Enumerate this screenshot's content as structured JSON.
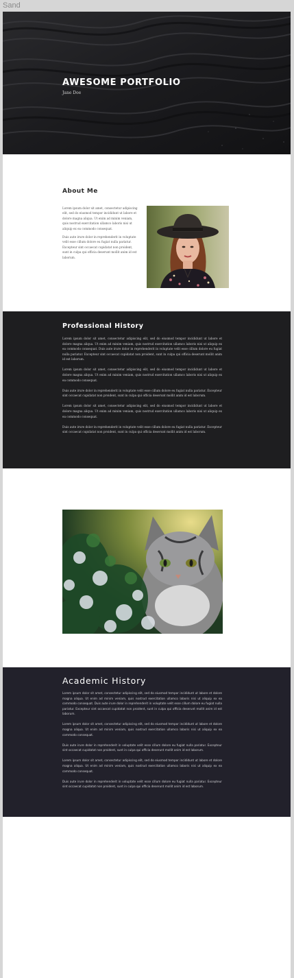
{
  "frame": {
    "label": "Sand"
  },
  "hero": {
    "title": "AWESOME PORTFOLIO",
    "subtitle": "Jane Doe",
    "background_image": "dark-sand-dunes-photo"
  },
  "about": {
    "heading": "About Me",
    "paragraphs": [
      "Lorem ipsum dolor sit amet, consectetur adipiscing elit, sed do eiusmod tempor incididunt ut labore et dolore magna aliqua. Ut enim ad minim veniam, quis nostrud exercitation ullamco laboris nisi ut aliquip ex ea commodo consequat.",
      "Duis aute irure dolor in reprehenderit in voluptate velit esse cillum dolore eu fugiat nulla pariatur. Excepteur sint occaecat cupidatat non proident, sunt in culpa qui officia deserunt mollit anim id est laborum."
    ],
    "image": "portrait-woman-in-hat-photo"
  },
  "professional": {
    "heading": "Professional History",
    "paragraphs": [
      "Lorem ipsum dolor sit amet, consectetur adipiscing elit, sed do eiusmod tempor incididunt ut labore et dolore magna aliqua. Ut enim ad minim veniam, quis nostrud exercitation ullamco laboris nisi ut aliquip ex ea commodo consequat. Duis aute irure dolor in reprehenderit in voluptate velit esse cillum dolore eu fugiat nulla pariatur. Excepteur sint occaecat cupidatat non proident, sunt in culpa qui officia deserunt mollit anim id est laborum.",
      "Lorem ipsum dolor sit amet, consectetur adipiscing elit, sed do eiusmod tempor incididunt ut labore et dolore magna aliqua. Ut enim ad minim veniam, quis nostrud exercitation ullamco laboris nisi ut aliquip ex ea commodo consequat.",
      "Duis aute irure dolor in reprehenderit in voluptate velit esse cillum dolore eu fugiat nulla pariatur. Excepteur sint occaecat cupidatat non proident, sunt in culpa qui officia deserunt mollit anim id est laborum.",
      "Lorem ipsum dolor sit amet, consectetur adipiscing elit, sed do eiusmod tempor incididunt ut labore et dolore magna aliqua. Ut enim ad minim veniam, quis nostrud exercitation ullamco laboris nisi ut aliquip ex ea commodo consequat.",
      "Duis aute irure dolor in reprehenderit in voluptate velit esse cillum dolore eu fugiat nulla pariatur. Excepteur sint occaecat cupidatat non proident, sunt in culpa qui officia deserunt mollit anim id est laborum."
    ]
  },
  "gallery": {
    "image": "cat-in-foliage-photo"
  },
  "academic": {
    "heading": "Academic History",
    "paragraphs": [
      "Lorem ipsum dolor sit amet, consectetur adipiscing elit, sed do eiusmod tempor incididunt ut labore et dolore magna aliqua. Ut enim ad minim veniam, quis nostrud exercitation ullamco laboris nisi ut aliquip ex ea commodo consequat. Duis aute irure dolor in reprehenderit in voluptate velit esse cillum dolore eu fugiat nulla pariatur. Excepteur sint occaecat cupidatat non proident, sunt in culpa qui officia deserunt mollit anim id est laborum.",
      "Lorem ipsum dolor sit amet, consectetur adipiscing elit, sed do eiusmod tempor incididunt ut labore et dolore magna aliqua. Ut enim ad minim veniam, quis nostrud exercitation ullamco laboris nisi ut aliquip ex ea commodo consequat.",
      "Duis aute irure dolor in reprehenderit in voluptate velit esse cillum dolore eu fugiat nulla pariatur. Excepteur sint occaecat cupidatat non proident, sunt in culpa qui officia deserunt mollit anim id est laborum.",
      "Lorem ipsum dolor sit amet, consectetur adipiscing elit, sed do eiusmod tempor incididunt ut labore et dolore magna aliqua. Ut enim ad minim veniam, quis nostrud exercitation ullamco laboris nisi ut aliquip ex ea commodo consequat.",
      "Duis aute irure dolor in reprehenderit in voluptate velit esse cillum dolore eu fugiat nulla pariatur. Excepteur sint occaecat cupidatat non proident, sunt in culpa qui officia deserunt mollit anim id est laborum."
    ]
  },
  "colors": {
    "hero_bg": "#1a1a1c",
    "professional_bg": "#1e1e20",
    "academic_bg": "#22212b",
    "canvas_bg": "#d6d6d6"
  }
}
